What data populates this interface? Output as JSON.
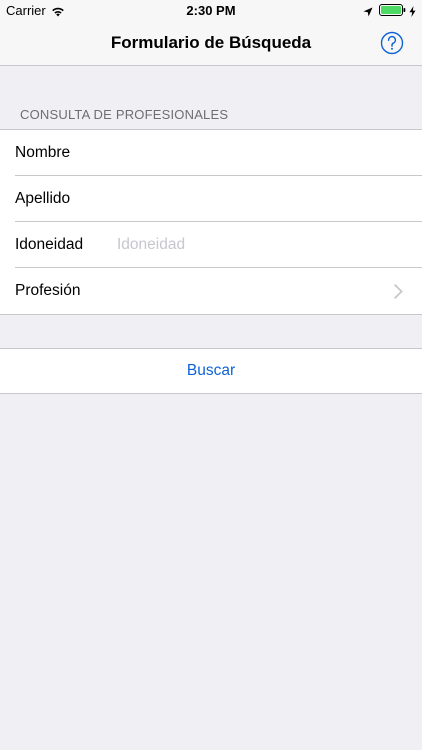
{
  "status_bar": {
    "carrier": "Carrier",
    "time": "2:30 PM",
    "icons": [
      "wifi-icon",
      "location-arrow-icon",
      "battery-icon",
      "charging-bolt-icon"
    ],
    "battery_color": "#4cd964"
  },
  "nav": {
    "title": "Formulario de Búsqueda",
    "help_icon": "help-circle-icon",
    "accent_color": "#0e62d4"
  },
  "form": {
    "section_header": "CONSULTA DE PROFESIONALES",
    "rows": [
      {
        "label": "Nombre",
        "value": "",
        "placeholder": ""
      },
      {
        "label": "Apellido",
        "value": "",
        "placeholder": ""
      },
      {
        "label": "Idoneidad",
        "value": "",
        "placeholder": "Idoneidad"
      },
      {
        "label": "Profesión",
        "icon": "chevron-right-icon"
      }
    ]
  },
  "actions": {
    "search_label": "Buscar"
  }
}
